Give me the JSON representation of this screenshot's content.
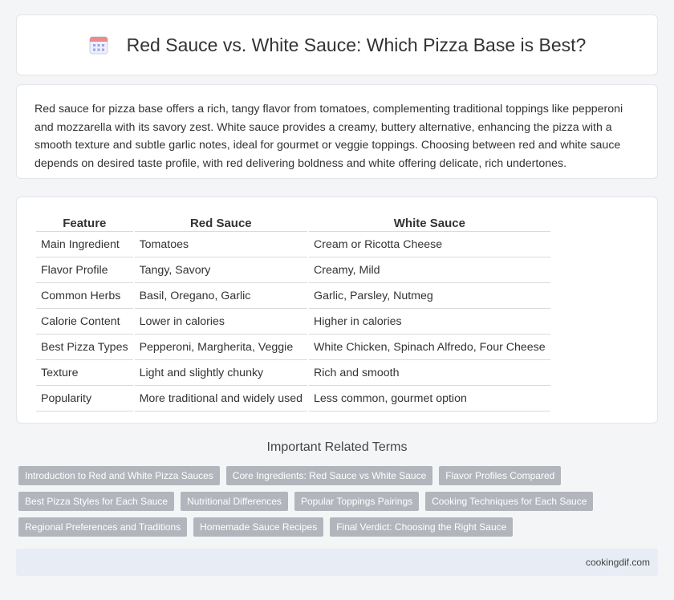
{
  "header": {
    "title": "Red Sauce vs. White Sauce: Which Pizza Base is Best?",
    "icon": "calendar-icon"
  },
  "intro": {
    "text": "Red sauce for pizza base offers a rich, tangy flavor from tomatoes, complementing traditional toppings like pepperoni and mozzarella with its savory zest. White sauce provides a creamy, buttery alternative, enhancing the pizza with a smooth texture and subtle garlic notes, ideal for gourmet or veggie toppings. Choosing between red and white sauce depends on desired taste profile, with red delivering boldness and white offering delicate, rich undertones."
  },
  "table": {
    "headers": [
      "Feature",
      "Red Sauce",
      "White Sauce"
    ],
    "rows": [
      [
        "Main Ingredient",
        "Tomatoes",
        "Cream or Ricotta Cheese"
      ],
      [
        "Flavor Profile",
        "Tangy, Savory",
        "Creamy, Mild"
      ],
      [
        "Common Herbs",
        "Basil, Oregano, Garlic",
        "Garlic, Parsley, Nutmeg"
      ],
      [
        "Calorie Content",
        "Lower in calories",
        "Higher in calories"
      ],
      [
        "Best Pizza Types",
        "Pepperoni, Margherita, Veggie",
        "White Chicken, Spinach Alfredo, Four Cheese"
      ],
      [
        "Texture",
        "Light and slightly chunky",
        "Rich and smooth"
      ],
      [
        "Popularity",
        "More traditional and widely used",
        "Less common, gourmet option"
      ]
    ]
  },
  "related": {
    "title": "Important Related Terms",
    "rows": [
      [
        "Introduction to Red and White Pizza Sauces",
        "Core Ingredients: Red Sauce vs White Sauce",
        "Flavor Profiles Compared"
      ],
      [
        "Best Pizza Styles for Each Sauce",
        "Nutritional Differences",
        "Popular Toppings Pairings",
        "Cooking Techniques for Each Sauce"
      ],
      [
        "Regional Preferences and Traditions",
        "Homemade Sauce Recipes",
        "Final Verdict: Choosing the Right Sauce"
      ]
    ]
  },
  "footer": {
    "site": "cookingdif.com"
  }
}
